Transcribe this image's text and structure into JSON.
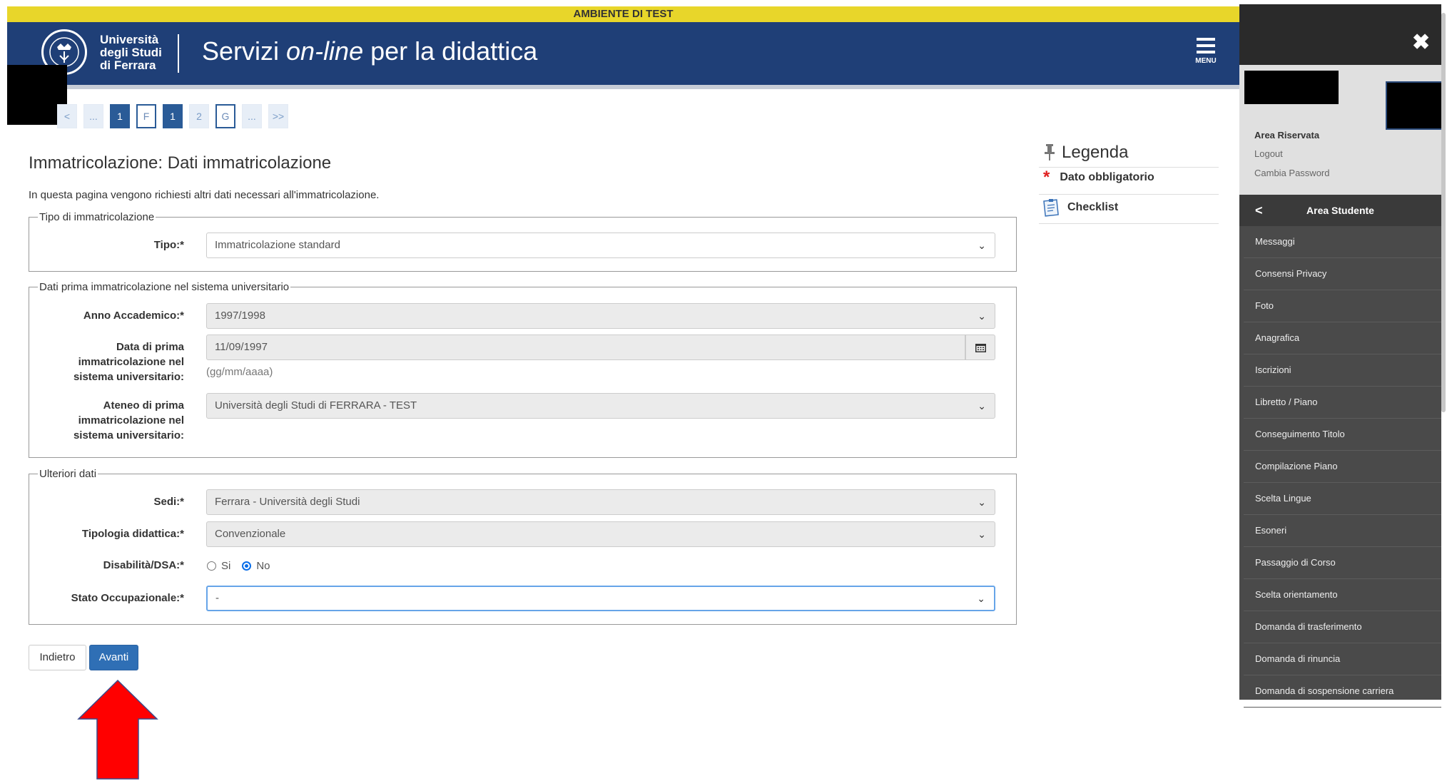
{
  "banner": "AMBIENTE DI TEST",
  "header": {
    "logo_line1": "Università",
    "logo_line2": "degli Studi",
    "logo_line3": "di Ferrara",
    "title_pre": "Servizi ",
    "title_em": "on-line",
    "title_post": " per la didattica",
    "menu_label": "MENU"
  },
  "steps": [
    "<",
    "...",
    "1",
    "F",
    "1",
    "2",
    "G",
    "...",
    ">>"
  ],
  "page": {
    "title": "Immatricolazione: Dati immatricolazione",
    "description": "In questa pagina vengono richiesti altri dati necessari all'immatricolazione."
  },
  "section1": {
    "legend": "Tipo di immatricolazione",
    "tipo_label": "Tipo:*",
    "tipo_value": "Immatricolazione standard"
  },
  "section2": {
    "legend": "Dati prima immatricolazione nel sistema universitario",
    "anno_label": "Anno Accademico:*",
    "anno_value": "1997/1998",
    "data_label_1": "Data di prima",
    "data_label_2": "immatricolazione nel",
    "data_label_3": "sistema universitario:",
    "data_value": "11/09/1997",
    "data_hint": "(gg/mm/aaaa)",
    "ateneo_label_1": "Ateneo di prima",
    "ateneo_label_2": "immatricolazione nel",
    "ateneo_label_3": "sistema universitario:",
    "ateneo_value": "Università degli Studi di FERRARA - TEST"
  },
  "section3": {
    "legend": "Ulteriori dati",
    "sedi_label": "Sedi:*",
    "sedi_value": "Ferrara - Università degli Studi",
    "tipologia_label": "Tipologia didattica:*",
    "tipologia_value": "Convenzionale",
    "disabilita_label": "Disabilità/DSA:*",
    "radio_si": "Si",
    "radio_no": "No",
    "radio_selected": "No",
    "stato_label": "Stato Occupazionale:*",
    "stato_value": "-"
  },
  "buttons": {
    "back": "Indietro",
    "next": "Avanti"
  },
  "legend_panel": {
    "title": "Legenda",
    "item1": "Dato obbligatorio",
    "item2": "Checklist"
  },
  "side_menu": {
    "area_riservata": "Area Riservata",
    "logout": "Logout",
    "cambia_password": "Cambia Password",
    "section_title": "Area Studente",
    "items": [
      "Messaggi",
      "Consensi Privacy",
      "Foto",
      "Anagrafica",
      "Iscrizioni",
      "Libretto / Piano",
      "Conseguimento Titolo",
      "Compilazione Piano",
      "Scelta Lingue",
      "Esoneri",
      "Passaggio di Corso",
      "Scelta orientamento",
      "Domanda di trasferimento",
      "Domanda di rinuncia",
      "Domanda di sospensione carriera"
    ]
  },
  "colors": {
    "header_bg": "#1f3f77",
    "banner_bg": "#e8d62a",
    "primary_button": "#2f6fb5",
    "arrow_red": "#ff0000",
    "side_bg": "#4a4a4a"
  }
}
